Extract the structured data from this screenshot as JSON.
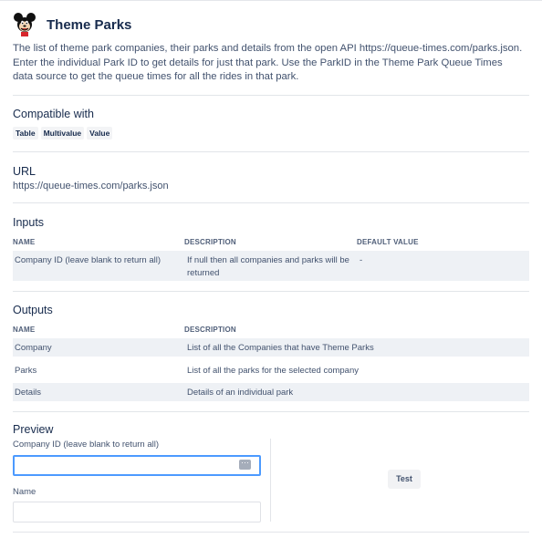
{
  "header": {
    "title": "Theme Parks",
    "logo_icon": "mickey-mouse-icon"
  },
  "description": "The list of theme park companies, their parks and details from the open API https://queue-times.com/parks.json. Enter the individual Park ID to get details for just that park. Use the ParkID in the Theme Park Queue Times data source to get the queue times for all the rides in that park.",
  "compatible": {
    "title": "Compatible with",
    "chips": [
      "Table",
      "Multivalue",
      "Value"
    ]
  },
  "url": {
    "title": "URL",
    "value": "https://queue-times.com/parks.json"
  },
  "inputs": {
    "title": "Inputs",
    "headers": [
      "NAME",
      "DESCRIPTION",
      "DEFAULT VALUE"
    ],
    "rows": [
      {
        "name": "Company ID (leave blank to return all)",
        "description_line1": "If null then all companies and parks will be",
        "description_line2": "returned",
        "default": "-"
      }
    ]
  },
  "outputs": {
    "title": "Outputs",
    "headers": [
      "NAME",
      "DESCRIPTION"
    ],
    "rows": [
      {
        "name": "Company",
        "description": "List of all the Companies that have Theme Parks"
      },
      {
        "name": "Parks",
        "description": "List of all the parks for the selected company"
      },
      {
        "name": "Details",
        "description": "Details of an individual park"
      }
    ]
  },
  "preview": {
    "title": "Preview",
    "field1_label": "Company ID (leave blank to return all)",
    "field1_value": "",
    "field2_label": "Name",
    "field2_value": "",
    "test_label": "Test"
  },
  "colors": {
    "accent_focus": "#4c9aff",
    "row_shade": "#eef1f5",
    "text": "#172b4d"
  }
}
